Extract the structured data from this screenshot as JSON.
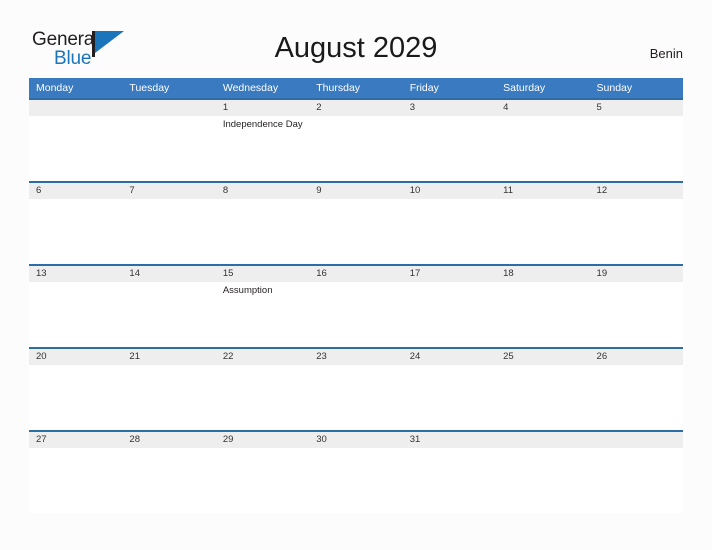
{
  "brand": {
    "name_top": "General",
    "name_bottom": "Blue",
    "flag_icon": "flag-triangle-icon",
    "color_top": "#231f20",
    "color_bottom": "#1b75bb"
  },
  "header": {
    "title": "August 2029",
    "country": "Benin"
  },
  "colors": {
    "header_blue": "#3a7ac0",
    "row_rule_blue": "#2e6da4",
    "day_band_gray": "#eeeeee",
    "page_background": "#fcfcfd"
  },
  "calendar": {
    "month": "August",
    "year": "2029",
    "weekday_headers": [
      "Monday",
      "Tuesday",
      "Wednesday",
      "Thursday",
      "Friday",
      "Saturday",
      "Sunday"
    ],
    "weeks": [
      [
        {
          "day": "",
          "events": []
        },
        {
          "day": "",
          "events": []
        },
        {
          "day": "1",
          "events": [
            "Independence Day"
          ]
        },
        {
          "day": "2",
          "events": []
        },
        {
          "day": "3",
          "events": []
        },
        {
          "day": "4",
          "events": []
        },
        {
          "day": "5",
          "events": []
        }
      ],
      [
        {
          "day": "6",
          "events": []
        },
        {
          "day": "7",
          "events": []
        },
        {
          "day": "8",
          "events": []
        },
        {
          "day": "9",
          "events": []
        },
        {
          "day": "10",
          "events": []
        },
        {
          "day": "11",
          "events": []
        },
        {
          "day": "12",
          "events": []
        }
      ],
      [
        {
          "day": "13",
          "events": []
        },
        {
          "day": "14",
          "events": []
        },
        {
          "day": "15",
          "events": [
            "Assumption"
          ]
        },
        {
          "day": "16",
          "events": []
        },
        {
          "day": "17",
          "events": []
        },
        {
          "day": "18",
          "events": []
        },
        {
          "day": "19",
          "events": []
        }
      ],
      [
        {
          "day": "20",
          "events": []
        },
        {
          "day": "21",
          "events": []
        },
        {
          "day": "22",
          "events": []
        },
        {
          "day": "23",
          "events": []
        },
        {
          "day": "24",
          "events": []
        },
        {
          "day": "25",
          "events": []
        },
        {
          "day": "26",
          "events": []
        }
      ],
      [
        {
          "day": "27",
          "events": []
        },
        {
          "day": "28",
          "events": []
        },
        {
          "day": "29",
          "events": []
        },
        {
          "day": "30",
          "events": []
        },
        {
          "day": "31",
          "events": []
        },
        {
          "day": "",
          "events": []
        },
        {
          "day": "",
          "events": []
        }
      ]
    ]
  }
}
